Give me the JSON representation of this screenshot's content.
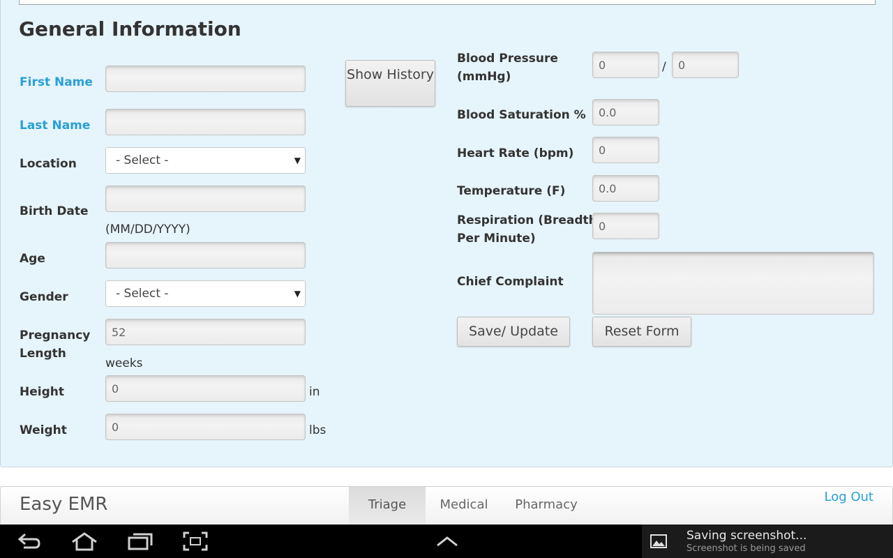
{
  "form": {
    "section_title": "General Information",
    "show_history_label": "Show History",
    "first_name": {
      "label": "First Name",
      "value": ""
    },
    "last_name": {
      "label": "Last Name",
      "value": ""
    },
    "location": {
      "label": "Location",
      "selected": "- Select -"
    },
    "birth_date": {
      "label": "Birth Date",
      "value": "",
      "hint": "(MM/DD/YYYY)"
    },
    "age": {
      "label": "Age",
      "value": ""
    },
    "gender": {
      "label": "Gender",
      "selected": "- Select -"
    },
    "pregnancy_length": {
      "label_line1": "Pregnancy",
      "label_line2": "Length",
      "value": "52",
      "unit": "weeks"
    },
    "height": {
      "label": "Height",
      "value": "0",
      "unit": "in"
    },
    "weight": {
      "label": "Weight",
      "value": "0",
      "unit": "lbs"
    }
  },
  "vitals": {
    "blood_pressure": {
      "label_line1": "Blood Pressure",
      "label_line2": "(mmHg)",
      "systolic": "0",
      "separator": "/",
      "diastolic": "0"
    },
    "blood_saturation": {
      "label": "Blood Saturation %",
      "value": "0.0"
    },
    "heart_rate": {
      "label": "Heart Rate (bpm)",
      "value": "0"
    },
    "temperature": {
      "label": "Temperature (F)",
      "value": "0.0"
    },
    "respiration": {
      "label_line1": "Respiration (Breadths",
      "label_line2": "Per Minute)",
      "value": "0"
    },
    "chief_complaint": {
      "label": "Chief Complaint",
      "value": ""
    },
    "save_label": "Save/ Update",
    "reset_label": "Reset Form"
  },
  "appbar": {
    "title": "Easy EMR",
    "tabs": [
      {
        "label": "Triage",
        "active": true
      },
      {
        "label": "Medical",
        "active": false
      },
      {
        "label": "Pharmacy",
        "active": false
      }
    ],
    "logout_label": "Log Out"
  },
  "system_bar": {
    "icons": [
      "back-icon",
      "home-icon",
      "recent-apps-icon",
      "screenshot-icon",
      "chevron-up-icon",
      "image-icon"
    ],
    "notification_title": "Saving screenshot...",
    "notification_subtitle": "Screenshot is being saved"
  },
  "colors": {
    "panel_bg": "#e6f4fb",
    "required_label": "#2a9fd8",
    "link": "#2a9fd8",
    "system_bar": "#000000"
  }
}
